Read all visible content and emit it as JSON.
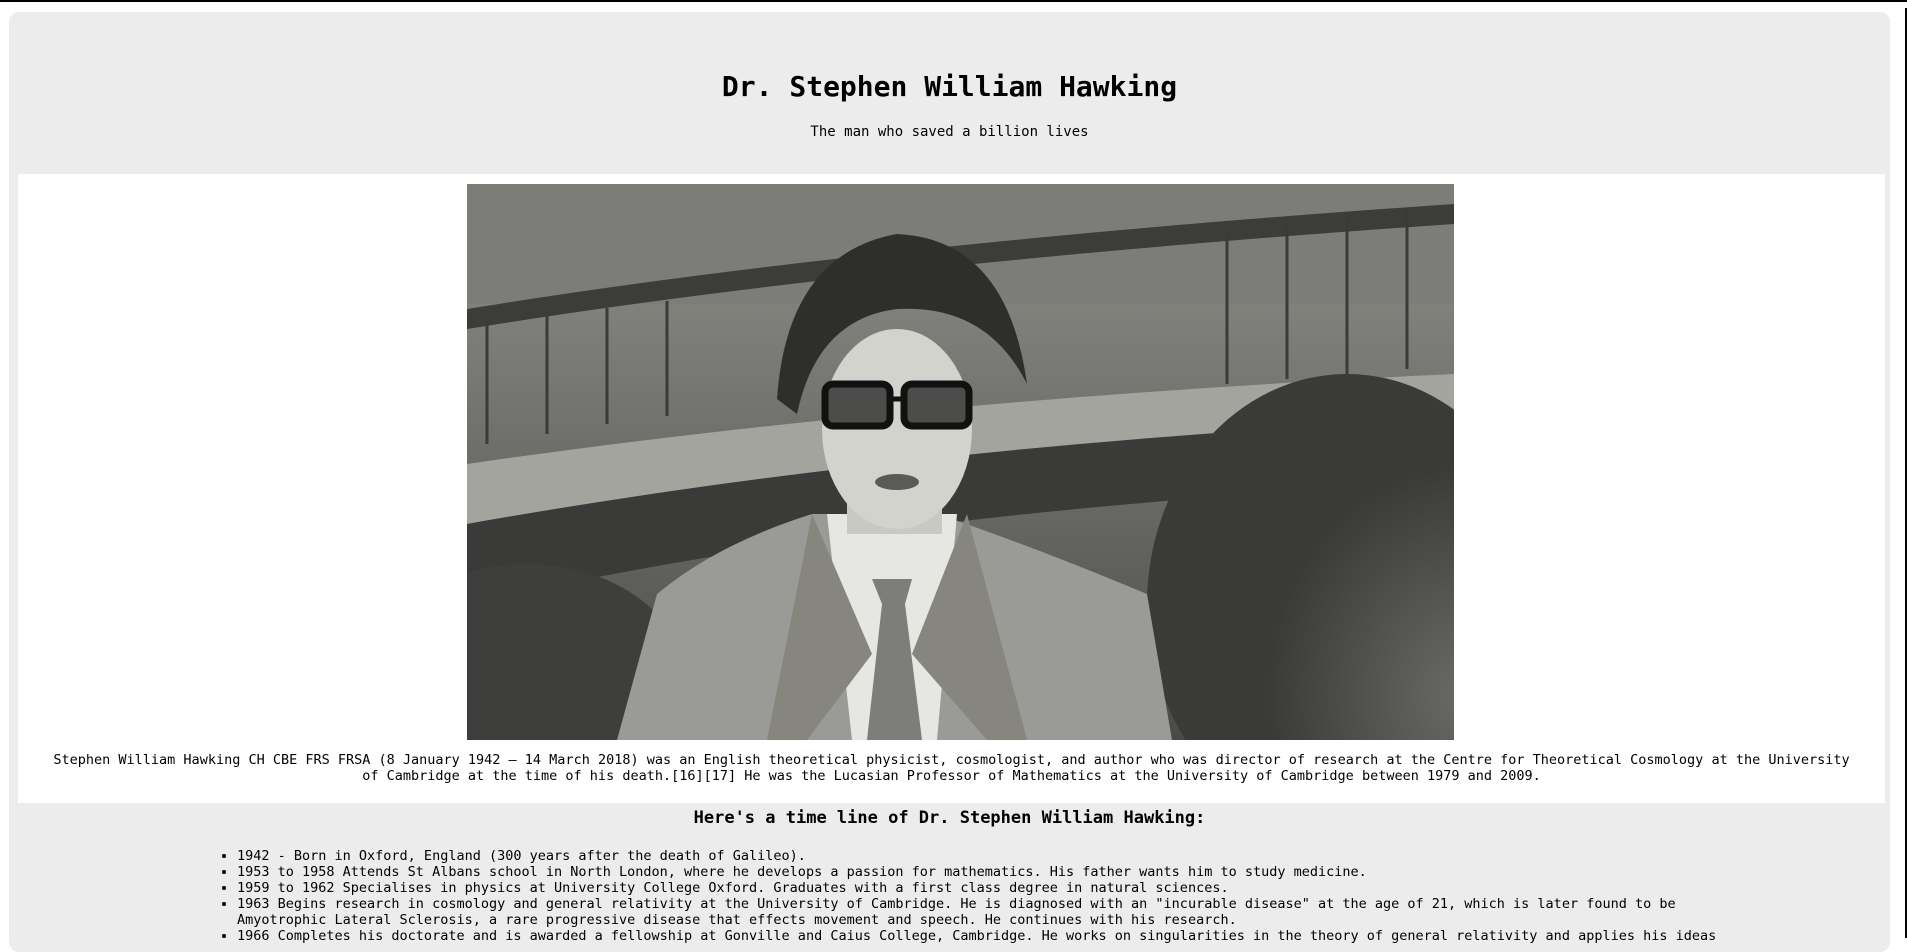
{
  "header": {
    "title": "Dr. Stephen William Hawking",
    "tagline": "The man who saved a billion lives"
  },
  "photo": {
    "description_icon": "portrait-photo"
  },
  "caption": "Stephen William Hawking CH CBE FRS FRSA (8 January 1942 – 14 March 2018) was an English theoretical physicist, cosmologist, and author who was director of research at the Centre for Theoretical Cosmology at the University of Cambridge at the time of his death.[16][17] He was the Lucasian Professor of Mathematics at the University of Cambridge between 1979 and 2009.",
  "timeline": {
    "title": "Here's a time line of Dr. Stephen William Hawking:",
    "items": [
      "1942 - Born in Oxford, England (300 years after the death of Galileo).",
      "1953 to 1958 Attends St Albans school in North London, where he develops a passion for mathematics. His father wants him to study medicine.",
      "1959 to 1962 Specialises in physics at University College Oxford. Graduates with a first class degree in natural sciences.",
      "1963 Begins research in cosmology and general relativity at the University of Cambridge. He is diagnosed with an \"incurable disease\" at the age of 21, which is later found to be Amyotrophic Lateral Sclerosis, a rare progressive disease that effects movement and speech. He continues with his research.",
      "1966 Completes his doctorate and is awarded a fellowship at Gonville and Caius College, Cambridge. He works on singularities in the theory of general relativity and applies his ideas"
    ]
  },
  "colors": {
    "page_bg": "#ffffff",
    "panel_bg": "#ececec",
    "image_panel_bg": "#ffffff",
    "text": "#000000"
  }
}
